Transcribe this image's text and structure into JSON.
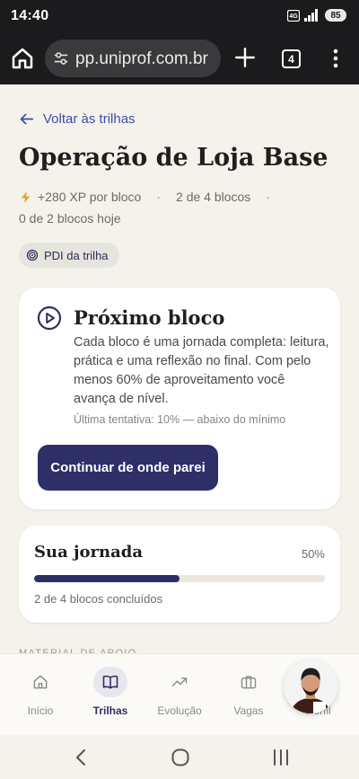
{
  "status_bar": {
    "time": "14:40",
    "battery": "85"
  },
  "browser": {
    "url": "pp.uniprof.com.br",
    "tab_count": "4"
  },
  "page": {
    "back_link": "Voltar às trilhas",
    "title": "Operação de Loja Base",
    "xp": "+280 XP por bloco",
    "separator": "·",
    "blocks_progress": "2 de 4 blocos",
    "today": "0 de 2 blocos hoje",
    "pdi_chip": "PDI da trilha",
    "section_peek": "MATERIAL DE APOIO"
  },
  "next_block": {
    "title": "Próximo bloco",
    "description": "Cada bloco é uma jornada completa: leitura, prática e uma reflexão no final. Com pelo menos 60% de aproveitamento você avança de nível.",
    "last_attempt": "Última tentativa: 10% — abaixo do mínimo",
    "cta_label": "Continuar de onde parei"
  },
  "journey": {
    "title": "Sua jornada",
    "percent_label": "50%",
    "progress_fraction": 0.5,
    "summary": "2 de 4 blocos concluídos"
  },
  "bottom_nav": {
    "items": [
      {
        "label": "Início",
        "icon": "home-icon",
        "active": false
      },
      {
        "label": "Trilhas",
        "icon": "book-icon",
        "active": true
      },
      {
        "label": "Evolução",
        "icon": "trending-up-icon",
        "active": false
      },
      {
        "label": "Vagas",
        "icon": "briefcase-icon",
        "active": false
      },
      {
        "label": "Perfil",
        "icon": "avatar",
        "active": false
      }
    ]
  },
  "colors": {
    "primary": "#2d2f66",
    "link": "#3a4fa8",
    "accent_bolt": "#e0a426",
    "background": "#f5f2eb"
  }
}
